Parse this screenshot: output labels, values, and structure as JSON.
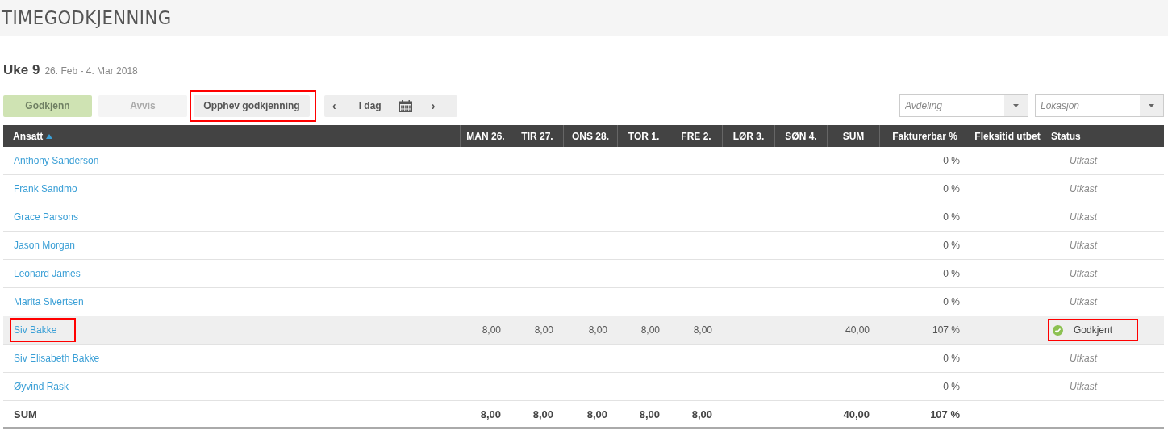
{
  "page_title": "TIMEGODKJENNING",
  "week": {
    "label": "Uke 9",
    "range": "26. Feb - 4. Mar 2018"
  },
  "toolbar": {
    "buttons": [
      {
        "label": "Godkjenn",
        "kind": "approve",
        "highlighted": false
      },
      {
        "label": "Avvis",
        "kind": "reject",
        "highlighted": false
      },
      {
        "label": "Opphev godkjenning",
        "kind": "plain",
        "highlighted": true
      }
    ],
    "prev": "‹",
    "today": "I dag",
    "next": "›"
  },
  "filters": [
    {
      "placeholder": "Avdeling"
    },
    {
      "placeholder": "Lokasjon"
    }
  ],
  "table": {
    "columns": [
      {
        "label": "Ansatt",
        "sorted": true
      },
      {
        "label": "MAN 26.",
        "sorted": false
      },
      {
        "label": "TIR 27.",
        "sorted": false
      },
      {
        "label": "ONS 28.",
        "sorted": false
      },
      {
        "label": "TOR 1.",
        "sorted": false
      },
      {
        "label": "FRE 2.",
        "sorted": false
      },
      {
        "label": "LØR 3.",
        "sorted": false
      },
      {
        "label": "SØN 4.",
        "sorted": false
      },
      {
        "label": "SUM",
        "sorted": false
      },
      {
        "label": "Fakturerbar %",
        "sorted": false
      },
      {
        "label": "Fleksitid utbet",
        "sorted": false
      },
      {
        "label": "Status",
        "sorted": false
      }
    ],
    "rows": [
      {
        "name": "Anthony Sanderson",
        "days": [],
        "sum": "",
        "billable": "0 %",
        "status": "Utkast",
        "kind": "draft",
        "selected": false,
        "highlighted": false
      },
      {
        "name": "Frank Sandmo",
        "days": [],
        "sum": "",
        "billable": "0 %",
        "status": "Utkast",
        "kind": "draft",
        "selected": false,
        "highlighted": false
      },
      {
        "name": "Grace Parsons",
        "days": [],
        "sum": "",
        "billable": "0 %",
        "status": "Utkast",
        "kind": "draft",
        "selected": false,
        "highlighted": false
      },
      {
        "name": "Jason Morgan",
        "days": [],
        "sum": "",
        "billable": "0 %",
        "status": "Utkast",
        "kind": "draft",
        "selected": false,
        "highlighted": false
      },
      {
        "name": "Leonard James",
        "days": [],
        "sum": "",
        "billable": "0 %",
        "status": "Utkast",
        "kind": "draft",
        "selected": false,
        "highlighted": false
      },
      {
        "name": "Marita Sivertsen",
        "days": [],
        "sum": "",
        "billable": "0 %",
        "status": "Utkast",
        "kind": "draft",
        "selected": false,
        "highlighted": false
      },
      {
        "name": "Siv Bakke",
        "days": [
          "8,00",
          "8,00",
          "8,00",
          "8,00",
          "8,00"
        ],
        "sum": "40,00",
        "billable": "107 %",
        "status": "Godkjent",
        "kind": "approved",
        "selected": true,
        "highlighted": true
      },
      {
        "name": "Siv Elisabeth Bakke",
        "days": [],
        "sum": "",
        "billable": "0 %",
        "status": "Utkast",
        "kind": "draft",
        "selected": false,
        "highlighted": false
      },
      {
        "name": "Øyvind Rask",
        "days": [],
        "sum": "",
        "billable": "0 %",
        "status": "Utkast",
        "kind": "draft",
        "selected": false,
        "highlighted": false
      }
    ],
    "total": {
      "label": "SUM",
      "days": [
        "8,00",
        "8,00",
        "8,00",
        "8,00",
        "8,00"
      ],
      "sum": "40,00",
      "billable": "107 %"
    }
  }
}
